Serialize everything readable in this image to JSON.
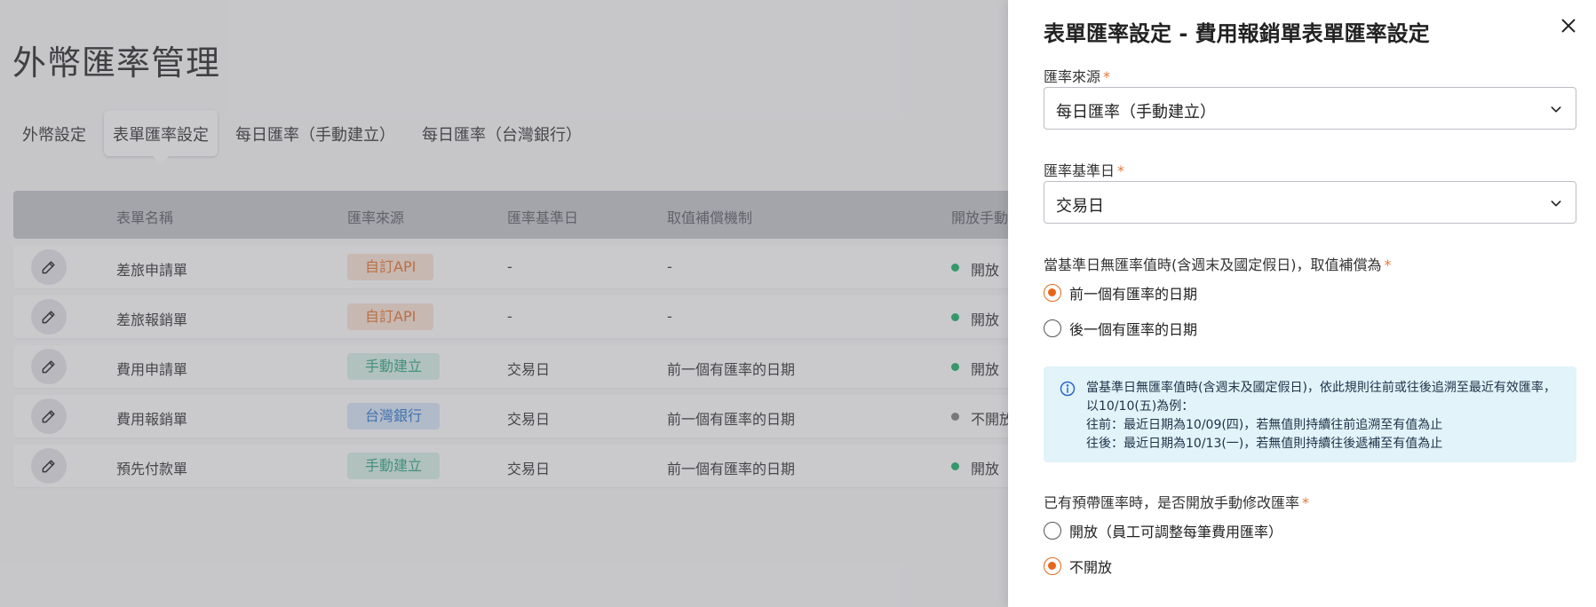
{
  "page": {
    "title": "外幣匯率管理",
    "tabs": [
      {
        "label": "外幣設定"
      },
      {
        "label": "表單匯率設定",
        "active": true
      },
      {
        "label": "每日匯率（手動建立）"
      },
      {
        "label": "每日匯率（台灣銀行）"
      }
    ],
    "table": {
      "headers": [
        "表單名稱",
        "匯率來源",
        "匯率基準日",
        "取值補償機制",
        "開放手動"
      ],
      "rows": [
        {
          "name": "差旅申請單",
          "source": "自訂API",
          "source_color": "#e97f3c",
          "source_bg": "#fbe5d8",
          "base_date": "-",
          "fallback": "-",
          "status": "開放",
          "status_color": "#2bb673"
        },
        {
          "name": "差旅報銷單",
          "source": "自訂API",
          "source_color": "#e97f3c",
          "source_bg": "#fbe5d8",
          "base_date": "-",
          "fallback": "-",
          "status": "開放",
          "status_color": "#2bb673"
        },
        {
          "name": "費用申請單",
          "source": "手動建立",
          "source_color": "#3fae8a",
          "source_bg": "#dcf2e8",
          "base_date": "交易日",
          "fallback": "前一個有匯率的日期",
          "status": "開放",
          "status_color": "#2bb673"
        },
        {
          "name": "費用報銷單",
          "source": "台灣銀行",
          "source_color": "#3c82d6",
          "source_bg": "#dbe8f8",
          "base_date": "交易日",
          "fallback": "前一個有匯率的日期",
          "status": "不開放",
          "status_color": "#8a8a8a"
        },
        {
          "name": "預先付款單",
          "source": "手動建立",
          "source_color": "#3fae8a",
          "source_bg": "#dcf2e8",
          "base_date": "交易日",
          "fallback": "前一個有匯率的日期",
          "status": "開放",
          "status_color": "#2bb673"
        }
      ]
    }
  },
  "panel": {
    "title": "表單匯率設定 - 費用報銷單表單匯率設定",
    "close_icon": "close-icon",
    "required_mark": "*",
    "source": {
      "label": "匯率來源",
      "value": "每日匯率（手動建立）"
    },
    "base_date": {
      "label": "匯率基準日",
      "value": "交易日"
    },
    "fallback": {
      "label": "當基準日無匯率值時(含週末及國定假日)，取值補償為",
      "options": [
        {
          "label": "前一個有匯率的日期",
          "checked": true
        },
        {
          "label": "後一個有匯率的日期",
          "checked": false
        }
      ]
    },
    "info": {
      "icon": "info-icon",
      "lines": [
        "當基準日無匯率值時(含週末及國定假日)，依此規則往前或往後追溯至最近有效匯率，",
        "以10/10(五)為例：",
        "往前：最近日期為10/09(四)，若無值則持續往前追溯至有值為止",
        "往後：最近日期為10/13(一)，若無值則持續往後遞補至有值為止"
      ]
    },
    "manual": {
      "label": "已有預帶匯率時，是否開放手動修改匯率",
      "options": [
        {
          "label": "開放（員工可調整每筆費用匯率）",
          "checked": false
        },
        {
          "label": "不開放",
          "checked": true
        }
      ]
    }
  },
  "colors": {
    "accent": "#e8661a",
    "required": "#e8773a",
    "info_bg": "#e2f3f9"
  }
}
